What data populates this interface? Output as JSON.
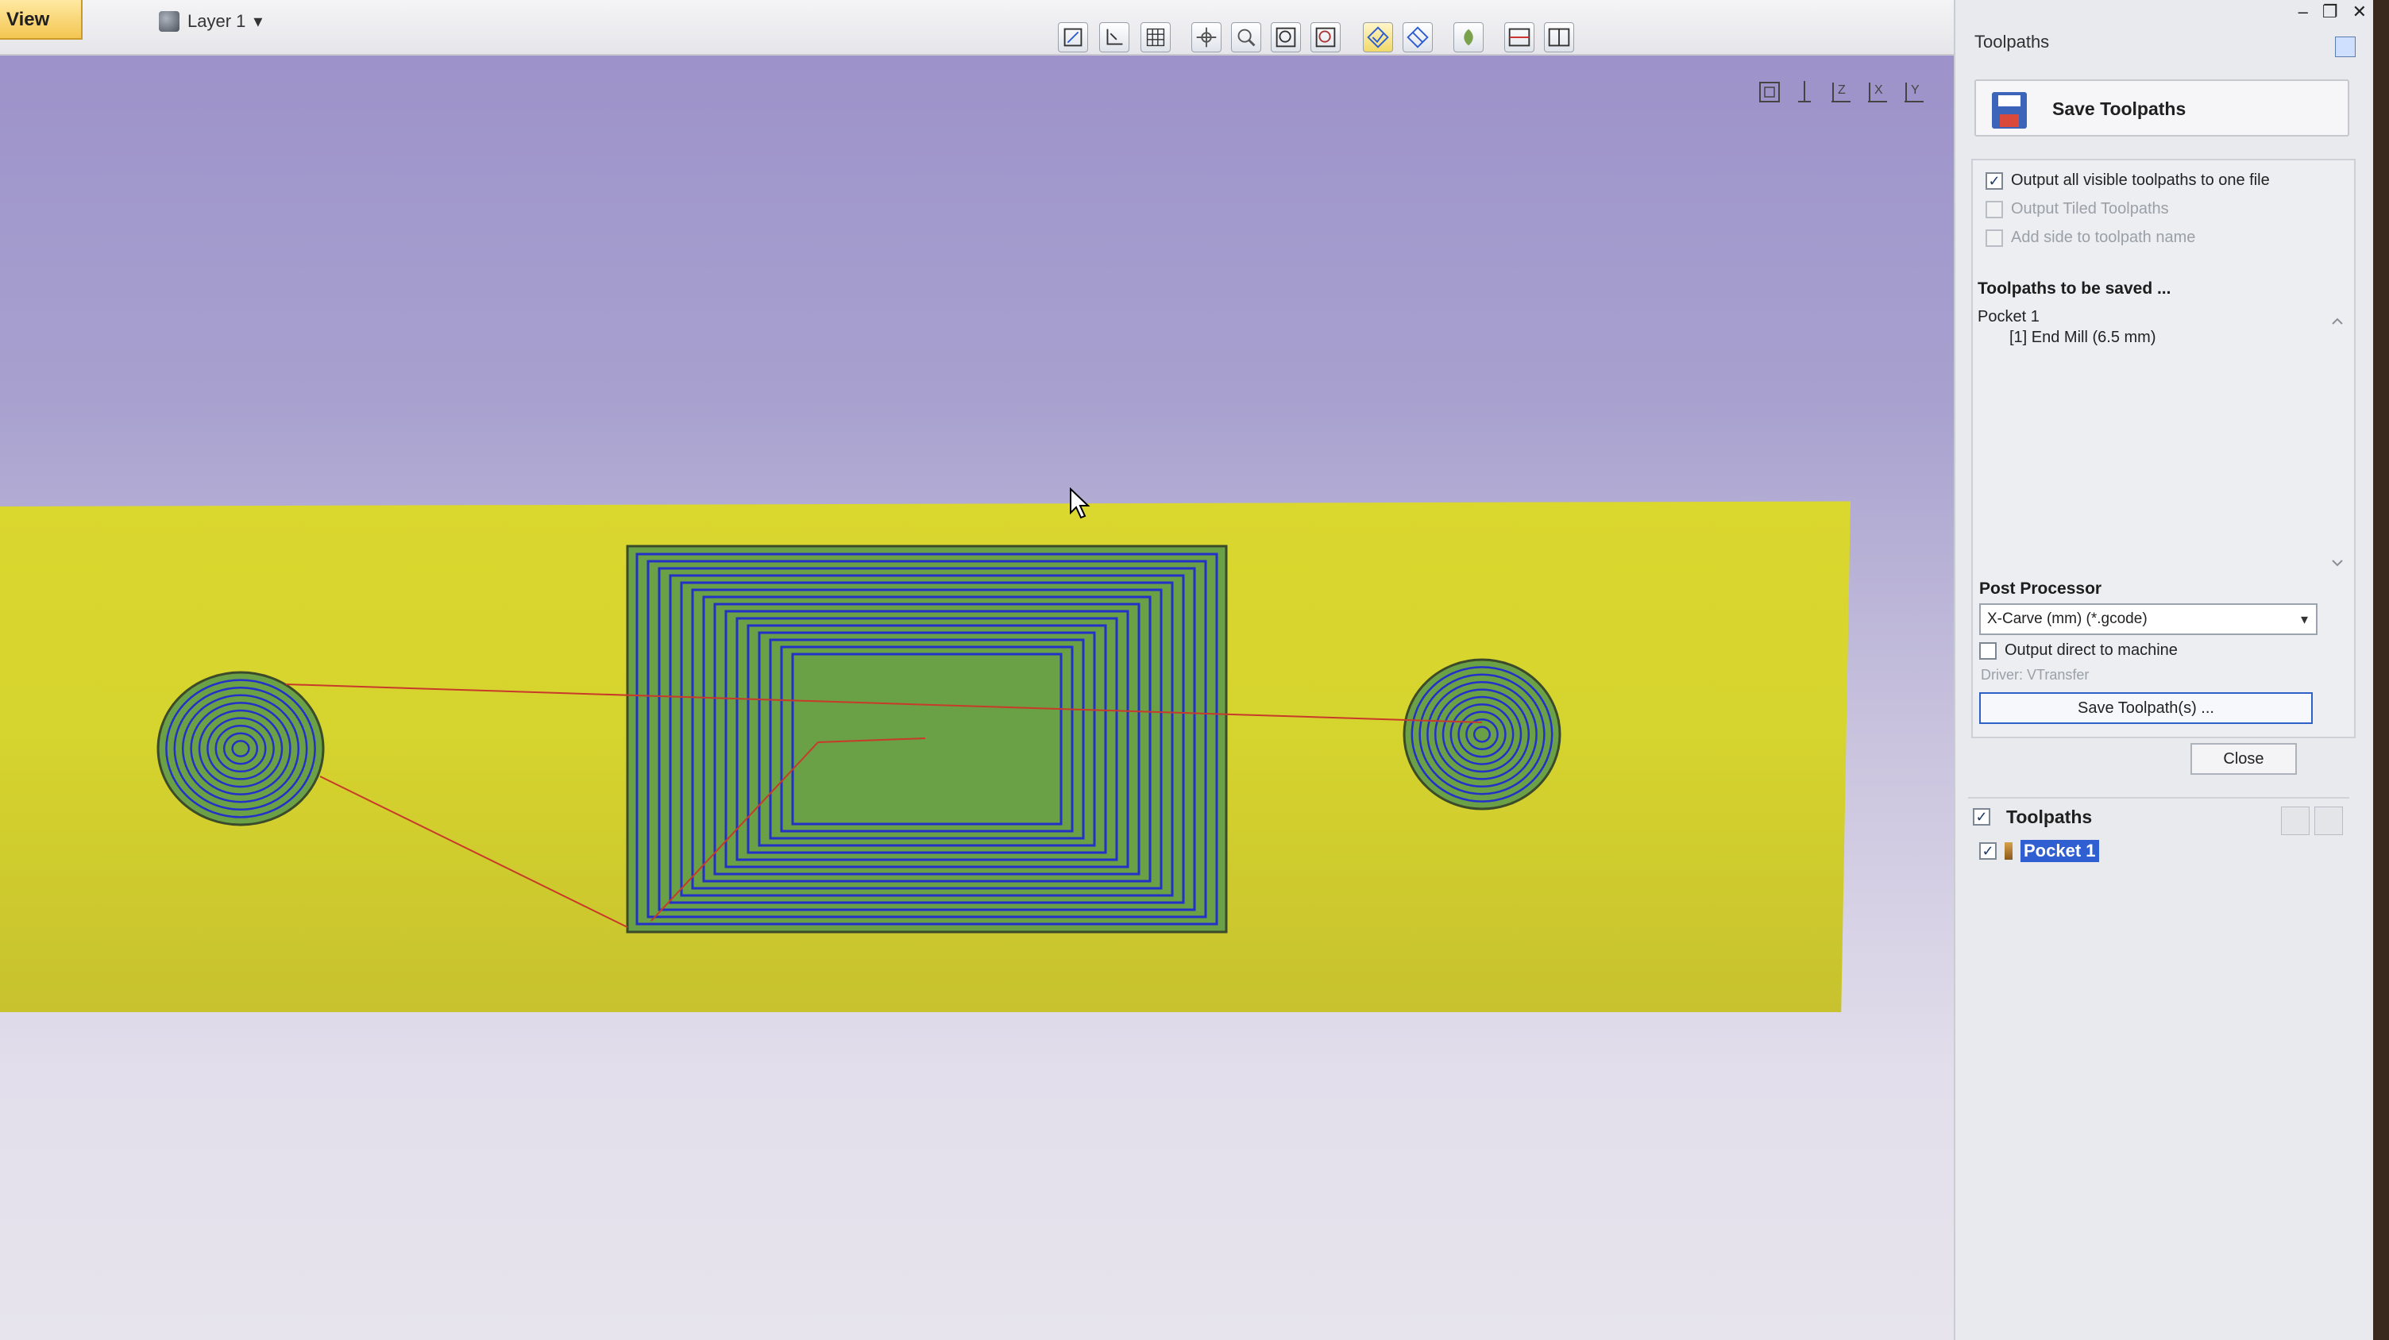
{
  "topbar": {
    "view_tab": "View",
    "layer": "Layer 1",
    "dropdown_indicator": "▾",
    "icons": [
      "fit-view-icon",
      "origin-icon",
      "grid-icon",
      "pan-icon",
      "zoom-box-icon",
      "zoom-in-icon",
      "zoom-out-icon",
      "toolpath-show-icon",
      "toolpath-hide-icon",
      "shade-icon",
      "split-horizontal-icon",
      "split-vertical-icon"
    ]
  },
  "viewport": {
    "view_icons": [
      "iso-view-icon",
      "x-axis-view-icon",
      "z-axis-view-icon",
      "x-side-view-icon",
      "y-side-view-icon"
    ],
    "axis_labels": [
      "Z",
      "X",
      "Y"
    ],
    "colors": {
      "material": "#d6d42e",
      "toolpath_blue": "#2331c8",
      "toolpath_green": "#6aa046",
      "rapid_red": "#c83a2a"
    }
  },
  "window_controls": [
    "–",
    "❐",
    "✕"
  ],
  "panel": {
    "title": "Toolpaths",
    "save_button": "Save Toolpaths",
    "options": [
      {
        "label": "Output all visible toolpaths to one file",
        "checked": true,
        "enabled": true
      },
      {
        "label": "Output Tiled Toolpaths",
        "checked": false,
        "enabled": false
      },
      {
        "label": "Add side to toolpath name",
        "checked": false,
        "enabled": false
      }
    ],
    "toolpaths_heading": "Toolpaths to be saved ...",
    "toolpaths": [
      {
        "name": "Pocket 1",
        "tool": "[1] End Mill (6.5 mm)"
      }
    ],
    "post_processor_heading": "Post Processor",
    "post_processor_value": "X-Carve (mm) (*.gcode)",
    "output_direct": "Output direct to machine",
    "driver": "Driver: VTransfer",
    "save_toolpaths_button": "Save Toolpath(s) ...",
    "close_button": "Close",
    "tree_heading": "Toolpaths",
    "tree_items": [
      {
        "name": "Pocket 1",
        "checked": true,
        "selected": true
      }
    ]
  }
}
